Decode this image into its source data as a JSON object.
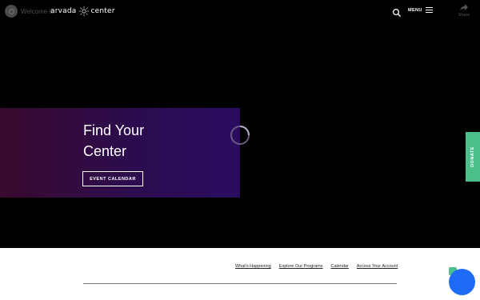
{
  "header": {
    "welcome_text": "Welcome to",
    "brand_left": "arvada",
    "brand_right": "center",
    "menu_label": "MENU",
    "share_label": "Share"
  },
  "hero": {
    "title_line1": "Find Your",
    "title_line2": "Center",
    "cta_label": "EVENT CALENDAR"
  },
  "donate_label": "DONATE",
  "subnav": {
    "items": [
      {
        "label": "What's Happening"
      },
      {
        "label": "Explore Our Programs"
      },
      {
        "label": "Calendar"
      },
      {
        "label": "Access Your Account"
      }
    ]
  },
  "colors": {
    "background": "#000000",
    "hero_gradient_start": "#3a0a2e",
    "hero_gradient_end": "#2a0d61",
    "donate_green": "#4dbf8c",
    "chat_blue": "#1e6bf5"
  },
  "icons": {
    "logo": "youtube-channel-icon",
    "search": "search-icon",
    "menu": "hamburger-icon",
    "share": "share-arrow-icon",
    "loading": "loading-spinner-icon",
    "chat": "chat-icon"
  }
}
